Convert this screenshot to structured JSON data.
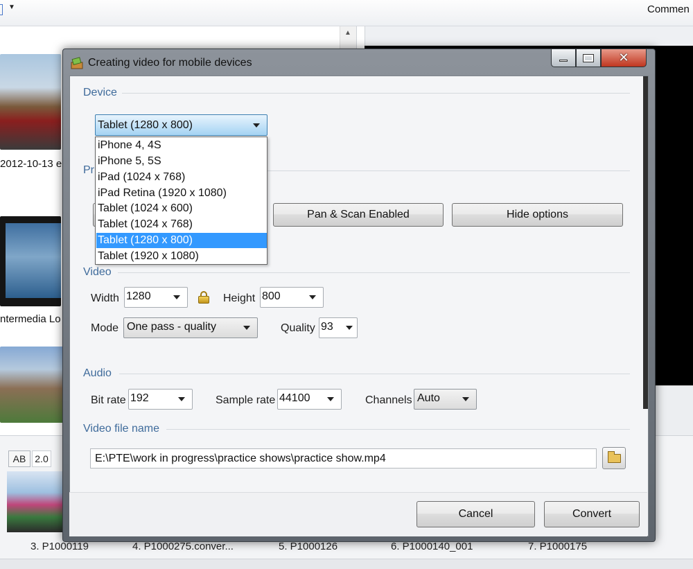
{
  "background": {
    "toolbar": {
      "comment_label": "Commen"
    },
    "thumbnails": [
      {
        "label": "2012-10-13 e"
      },
      {
        "label": "ntermedia Lo"
      }
    ],
    "bottom_bar": {
      "ab_label": "AB",
      "version_label": "2.0",
      "slides": [
        {
          "label": "3. P1000119"
        },
        {
          "label": "4. P1000275.conver..."
        },
        {
          "label": "5. P1000126"
        },
        {
          "label": "6. P1000140_001"
        },
        {
          "label": "7. P1000175"
        }
      ]
    }
  },
  "dialog": {
    "title": "Creating video for mobile devices",
    "device": {
      "section_title": "Device",
      "selected": "Tablet (1280 x 800)",
      "options": [
        "iPhone 4, 4S",
        "iPhone 5, 5S",
        "iPad (1024 x 768)",
        "iPad Retina (1920 x 1080)",
        "Tablet (1024 x 600)",
        "Tablet (1024 x 768)",
        "Tablet (1280 x 800)",
        "Tablet (1920 x 1080)"
      ],
      "selected_index": 6
    },
    "preset": {
      "section_title_partial": "Pr",
      "pan_scan_label": "Pan & Scan Enabled",
      "hide_options_label": "Hide options"
    },
    "video": {
      "section_title": "Video",
      "width_label": "Width",
      "width_value": "1280",
      "height_label": "Height",
      "height_value": "800",
      "mode_label": "Mode",
      "mode_value": "One pass - quality",
      "quality_label": "Quality",
      "quality_value": "93"
    },
    "audio": {
      "section_title": "Audio",
      "bitrate_label": "Bit rate",
      "bitrate_value": "192",
      "samplerate_label": "Sample rate",
      "samplerate_value": "44100",
      "channels_label": "Channels",
      "channels_value": "Auto"
    },
    "file": {
      "section_title": "Video file name",
      "path": "E:\\PTE\\work in progress\\practice shows\\practice show.mp4"
    },
    "footer": {
      "cancel_label": "Cancel",
      "convert_label": "Convert"
    }
  },
  "colors": {
    "section_title": "#3f6b9b",
    "selection": "#3399ff",
    "close_button": "#c0361f"
  }
}
